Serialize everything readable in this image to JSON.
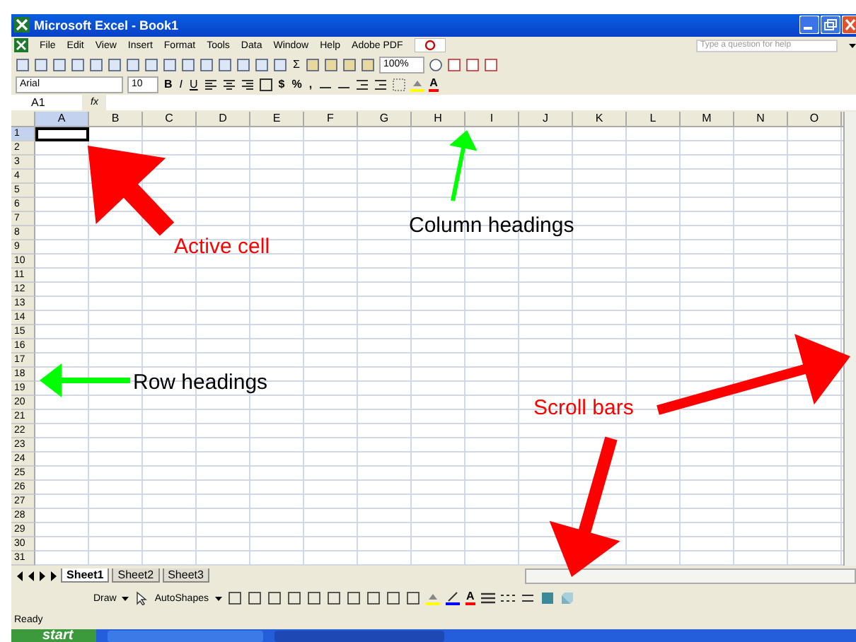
{
  "window": {
    "title": "Microsoft Excel - Book1"
  },
  "menu": [
    "File",
    "Edit",
    "View",
    "Insert",
    "Format",
    "Tools",
    "Data",
    "Window",
    "Help",
    "Adobe PDF"
  ],
  "help_box": {
    "placeholder": "Type a question for help"
  },
  "standard_toolbar": {
    "sum": "Σ",
    "zoom": "100%"
  },
  "formatting_toolbar": {
    "font": "Arial",
    "size": "10",
    "styles": [
      "B",
      "I",
      "U"
    ],
    "number_formats": [
      "$",
      "%",
      ","
    ],
    "font_color": "A"
  },
  "formula_bar": {
    "name_box": "A1",
    "fx": "fx"
  },
  "columns": [
    {
      "label": "A",
      "selected": true
    },
    {
      "label": "B",
      "selected": false
    },
    {
      "label": "C",
      "selected": false
    },
    {
      "label": "D",
      "selected": false
    },
    {
      "label": "E",
      "selected": false
    },
    {
      "label": "F",
      "selected": false
    },
    {
      "label": "G",
      "selected": false
    },
    {
      "label": "H",
      "selected": false
    },
    {
      "label": "I",
      "selected": false
    },
    {
      "label": "J",
      "selected": false
    },
    {
      "label": "K",
      "selected": false
    },
    {
      "label": "L",
      "selected": false
    },
    {
      "label": "M",
      "selected": false
    },
    {
      "label": "N",
      "selected": false
    },
    {
      "label": "O",
      "selected": false
    }
  ],
  "rows": [
    "1",
    "2",
    "3",
    "4",
    "5",
    "6",
    "7",
    "8",
    "9",
    "10",
    "11",
    "12",
    "13",
    "14",
    "15",
    "16",
    "17",
    "18",
    "19",
    "20",
    "21",
    "22",
    "23",
    "24",
    "25",
    "26",
    "27",
    "28",
    "29",
    "30",
    "31"
  ],
  "sheet_tabs": [
    {
      "label": "Sheet1",
      "selected": true
    },
    {
      "label": "Sheet2",
      "selected": false
    },
    {
      "label": "Sheet3",
      "selected": false
    }
  ],
  "drawing_toolbar": {
    "draw": "Draw",
    "autoshapes": "AutoShapes",
    "font_color": "A"
  },
  "status_bar": "Ready",
  "taskbar": {
    "start": "start"
  },
  "callouts": [
    {
      "text": "Active cell",
      "color": "#ff0000"
    },
    {
      "text": "Column headings",
      "color": "#000000"
    },
    {
      "text": "Row headings",
      "color": "#000000"
    },
    {
      "text": "Scroll bars",
      "color": "#ff0000"
    }
  ],
  "arrows": [
    {
      "color": "#ff0000"
    },
    {
      "color": "#00ff00"
    },
    {
      "color": "#00ff00"
    },
    {
      "color": "#ff0000"
    },
    {
      "color": "#ff0000"
    }
  ]
}
